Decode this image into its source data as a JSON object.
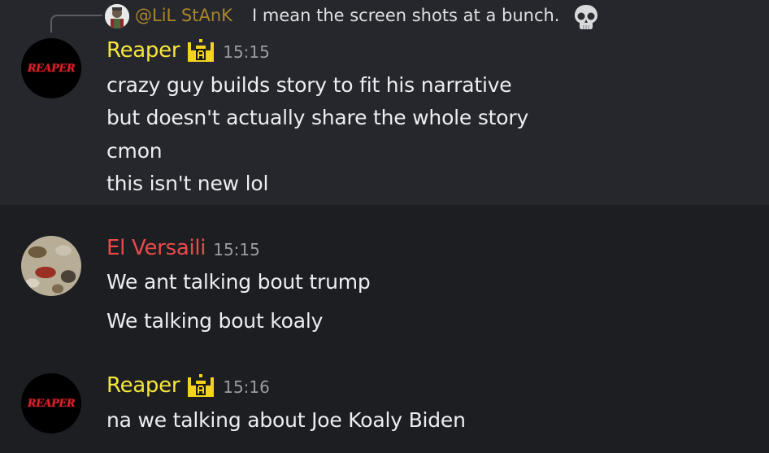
{
  "reply": {
    "author": "@LiL StAnK",
    "text": "I mean the screen shots at a bunch.",
    "trailing_icon": "skull-emoji"
  },
  "messages": [
    {
      "author": "Reaper",
      "author_color": "#f5e63c",
      "avatar_text": "REAPER",
      "badge_icon": "crown-badge-icon",
      "timestamp": "15:15",
      "lines": [
        "crazy guy builds story to fit his narrative",
        "but doesn't actually share the whole story",
        "cmon",
        "this isn't new lol"
      ]
    },
    {
      "author": "El Versaili",
      "author_color": "#ea4a4a",
      "timestamp": "15:15",
      "lines": [
        "We ant talking bout trump",
        "We talking bout koaly"
      ]
    },
    {
      "author": "Reaper",
      "author_color": "#f5e63c",
      "avatar_text": "REAPER",
      "badge_icon": "crown-badge-icon",
      "timestamp": "15:16",
      "lines": [
        "na we talking about Joe Koaly Biden"
      ]
    }
  ]
}
